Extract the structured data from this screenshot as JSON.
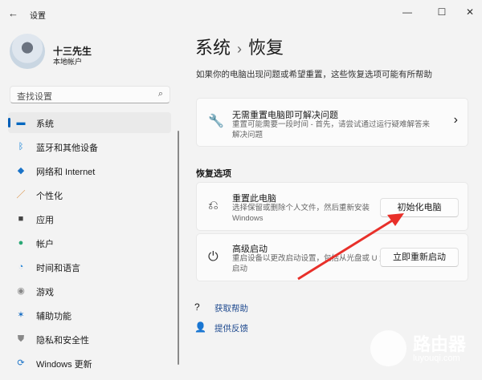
{
  "window": {
    "title": "设置",
    "back": "←",
    "min": "—",
    "max": "☐",
    "close": "✕"
  },
  "user": {
    "name": "十三先生",
    "type": "本地帐户"
  },
  "search": {
    "placeholder": "查找设置",
    "icon": "⌕"
  },
  "sidebar": {
    "items": [
      {
        "label": "系统",
        "icon": "▬",
        "color": "#0067c0"
      },
      {
        "label": "蓝牙和其他设备",
        "icon": "ᛒ",
        "color": "#0078d4"
      },
      {
        "label": "网络和 Internet",
        "icon": "◆",
        "color": "#1a73c8"
      },
      {
        "label": "个性化",
        "icon": "／",
        "color": "#d88a3a"
      },
      {
        "label": "应用",
        "icon": "■",
        "color": "#444"
      },
      {
        "label": "帐户",
        "icon": "●",
        "color": "#2aa876"
      },
      {
        "label": "时间和语言",
        "icon": "◔",
        "color": "#2b88d8"
      },
      {
        "label": "游戏",
        "icon": "◉",
        "color": "#888"
      },
      {
        "label": "辅助功能",
        "icon": "✶",
        "color": "#1a6fc4"
      },
      {
        "label": "隐私和安全性",
        "icon": "⛊",
        "color": "#888"
      },
      {
        "label": "Windows 更新",
        "icon": "⟳",
        "color": "#1a73c8"
      }
    ]
  },
  "header": {
    "crumb1": "系统",
    "sep": "›",
    "crumb2": "恢复",
    "subtitle": "如果你的电脑出现问题或希望重置，这些恢复选项可能有所帮助"
  },
  "fix": {
    "title": "无需重置电脑即可解决问题",
    "desc": "重置可能需要一段时间 - 首先，请尝试通过运行疑难解答来解决问题",
    "chevron": "›",
    "icon": "🔧"
  },
  "section": "恢复选项",
  "reset": {
    "title": "重置此电脑",
    "desc": "选择保留或删除个人文件，然后重新安装 Windows",
    "button": "初始化电脑",
    "icon": "⎌"
  },
  "advanced": {
    "title": "高级启动",
    "desc": "重启设备以更改启动设置，包括从光盘或 U 盘启动",
    "button": "立即重新启动",
    "icon": "⏻"
  },
  "links": [
    {
      "label": "获取帮助",
      "icon": "?"
    },
    {
      "label": "提供反馈",
      "icon": "👤"
    }
  ],
  "watermark": {
    "brand": "路由器",
    "url": "luyouqi.com"
  }
}
